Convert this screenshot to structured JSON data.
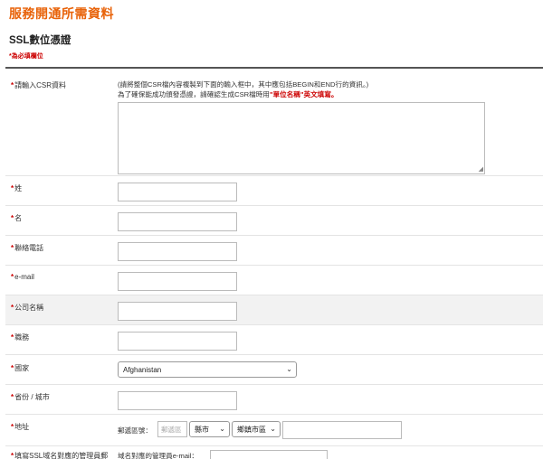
{
  "header": {
    "page_title": "服務開通所需資料",
    "section_title": "SSL數位憑證",
    "required_note": "*為必填欄位"
  },
  "form": {
    "csr": {
      "label": "請輸入CSR資料",
      "note_line1": "(請將整個CSR檔內容複製到下面的輸入框中，其中應包括BEGIN和END行的資訊。)",
      "note_line2_pre": "為了確保能成功頒發憑證，請確認生成CSR檔時用",
      "note_line2_highlight": "\"單位名稱\"英文填寫",
      "note_line2_post": "。",
      "value": ""
    },
    "last_name": {
      "label": "姓",
      "value": ""
    },
    "first_name": {
      "label": "名",
      "value": ""
    },
    "phone": {
      "label": "聯絡電話",
      "value": ""
    },
    "email": {
      "label": "e-mail",
      "value": ""
    },
    "company": {
      "label": "公司名稱",
      "value": ""
    },
    "job_title": {
      "label": "職務",
      "value": ""
    },
    "country": {
      "label": "國家",
      "selected": "Afghanistan"
    },
    "province": {
      "label": "省份 / 城市",
      "value": ""
    },
    "address": {
      "label": "地址",
      "zip_label": "郵遞區號：",
      "zip_placeholder": "郵遞區",
      "county_selected": "縣市",
      "town_selected": "鄉鎮市區",
      "street_value": ""
    },
    "admin": {
      "label": "填寫SSL域名對應的管理員郵",
      "sub_label": "域名對應的管理員e-mail：",
      "value": ""
    }
  }
}
